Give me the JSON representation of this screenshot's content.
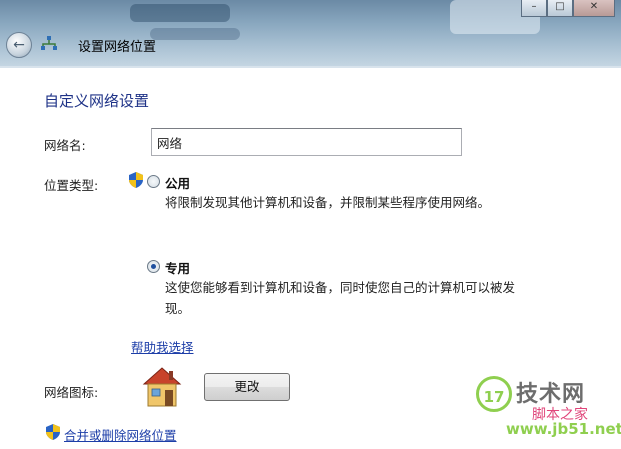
{
  "window": {
    "breadcrumb_title": "设置网络位置"
  },
  "page": {
    "heading": "自定义网络设置",
    "network_name_label": "网络名:",
    "network_name_value": "网络",
    "location_type_label": "位置类型:",
    "options": [
      {
        "label": "公用",
        "selected": false,
        "description": "将限制发现其他计算机和设备，并限制某些程序使用网络。"
      },
      {
        "label": "专用",
        "selected": true,
        "description_line1": "这使您能够看到计算机和设备，同时使您自己的计算机可以被发",
        "description_line2": "现。"
      }
    ],
    "help_link": "帮助我选择",
    "network_icon_label": "网络图标:",
    "change_button": "更改",
    "merge_link": "合并或删除网络位置"
  },
  "watermark": {
    "badge": "17",
    "main": "技术网",
    "sub": "脚本之家",
    "url": "www.jb51.net"
  },
  "colors": {
    "heading": "#1e3287",
    "link": "#1d3ea8"
  }
}
